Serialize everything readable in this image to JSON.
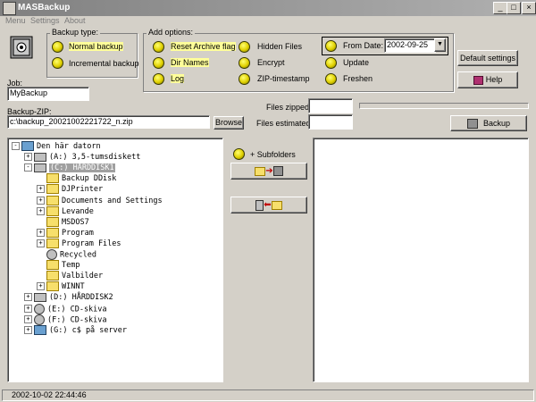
{
  "window": {
    "title": "MASBackup",
    "buttons": [
      "_",
      "□",
      "×"
    ]
  },
  "menu": [
    "Menu",
    "Settings",
    "About"
  ],
  "backup_type": {
    "title": "Backup type:",
    "options": [
      {
        "label": "Normal backup",
        "selected": true
      },
      {
        "label": "Incremental backup",
        "selected": false
      }
    ]
  },
  "add_options": {
    "title": "Add options:",
    "options": [
      {
        "label": "Reset Archive flag"
      },
      {
        "label": "Dir Names"
      },
      {
        "label": "Log"
      },
      {
        "label": "Hidden Files"
      },
      {
        "label": "Encrypt"
      },
      {
        "label": "ZIP-timestamp"
      },
      {
        "label": "From Date:"
      },
      {
        "label": "Update"
      },
      {
        "label": "Freshen"
      }
    ],
    "from_date": "2002-09-25"
  },
  "buttons": {
    "default_settings": "Default settings",
    "help": "Help",
    "browse": "Browse",
    "backup": "Backup",
    "subfolders": "+ Subfolders"
  },
  "job": {
    "label": "Job:",
    "value": "MyBackup"
  },
  "zip": {
    "label": "Backup-ZIP:",
    "value": "c:\\backup_20021002221722_n.zip"
  },
  "counters": {
    "files_zipped_label": "Files zipped:",
    "files_estimated_label": "Files estimated:"
  },
  "tree": [
    {
      "text": "Den här datorn",
      "level": 0,
      "exp": "-",
      "icon": "computer-icon"
    },
    {
      "text": "(A:) 3,5-tumsdiskett",
      "level": 1,
      "exp": "+",
      "icon": "floppy-drive-icon"
    },
    {
      "text": "(C:) HÅRDDISK1",
      "level": 1,
      "exp": "-",
      "icon": "hard-drive-icon",
      "selected": true
    },
    {
      "text": "Backup DDisk",
      "level": 2,
      "exp": "",
      "icon": "folder-icon"
    },
    {
      "text": "DJPrinter",
      "level": 2,
      "exp": "+",
      "icon": "folder-icon"
    },
    {
      "text": "Documents and Settings",
      "level": 2,
      "exp": "+",
      "icon": "folder-icon"
    },
    {
      "text": "Levande",
      "level": 2,
      "exp": "+",
      "icon": "folder-icon"
    },
    {
      "text": "MSDOS7",
      "level": 2,
      "exp": "",
      "icon": "folder-icon"
    },
    {
      "text": "Program",
      "level": 2,
      "exp": "+",
      "icon": "folder-icon"
    },
    {
      "text": "Program Files",
      "level": 2,
      "exp": "+",
      "icon": "folder-icon"
    },
    {
      "text": "Recycled",
      "level": 2,
      "exp": "",
      "icon": "recycle-bin-icon"
    },
    {
      "text": "Temp",
      "level": 2,
      "exp": "",
      "icon": "folder-icon"
    },
    {
      "text": "Valbilder",
      "level": 2,
      "exp": "",
      "icon": "folder-icon"
    },
    {
      "text": "WINNT",
      "level": 2,
      "exp": "+",
      "icon": "folder-icon"
    },
    {
      "text": "(D:) HÅRDDISK2",
      "level": 1,
      "exp": "+",
      "icon": "hard-drive-icon"
    },
    {
      "text": "(E:) CD-skiva",
      "level": 1,
      "exp": "+",
      "icon": "cd-drive-icon"
    },
    {
      "text": "(F:) CD-skiva",
      "level": 1,
      "exp": "+",
      "icon": "cd-drive-icon"
    },
    {
      "text": "(G:) c$ på server",
      "level": 1,
      "exp": "+",
      "icon": "network-drive-icon"
    }
  ],
  "status": {
    "timestamp": "2002-10-02 22:44:46"
  },
  "colors": {
    "face": "#d4d0c8",
    "highlight": "#ffff99",
    "radio": "#e0d000"
  }
}
